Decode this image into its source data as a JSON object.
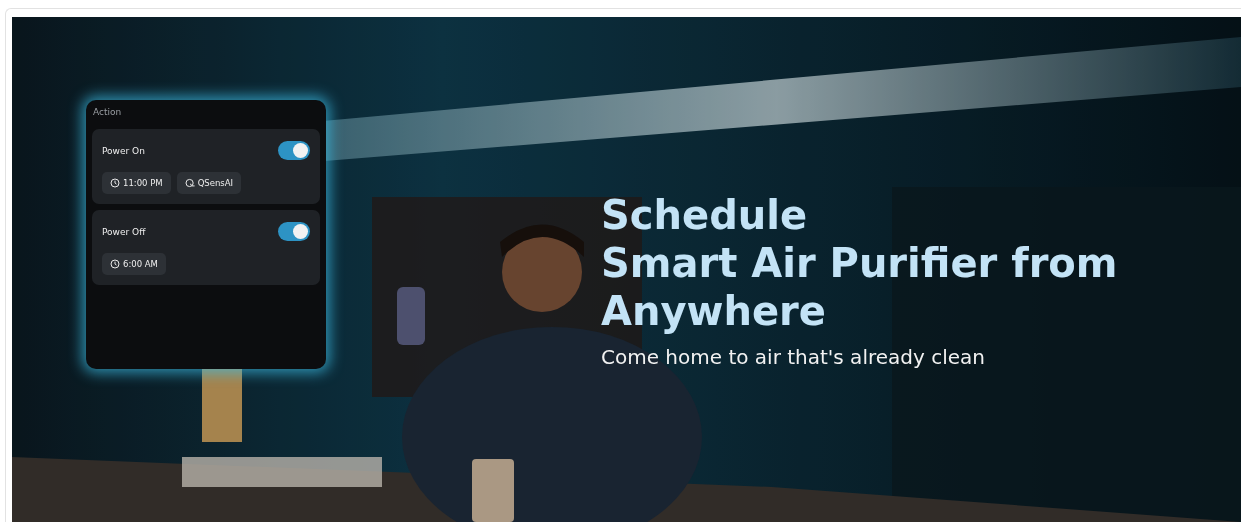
{
  "banner": {
    "kind": "picture",
    "action_card": {
      "title": "Action",
      "actions": [
        {
          "label": "Power On",
          "on": true,
          "chips": [
            {
              "kind": "time",
              "text": "11:00 PM"
            },
            {
              "kind": "mode",
              "text": "QSensAI"
            }
          ]
        },
        {
          "label": "Power Off",
          "on": true,
          "chips": [
            {
              "kind": "time",
              "text": "6:00 AM"
            }
          ]
        }
      ]
    },
    "headline": [
      "Schedule",
      "Smart Air Purifier from",
      "Anywhere"
    ],
    "subtitle": "Come home to air that's already clean"
  }
}
